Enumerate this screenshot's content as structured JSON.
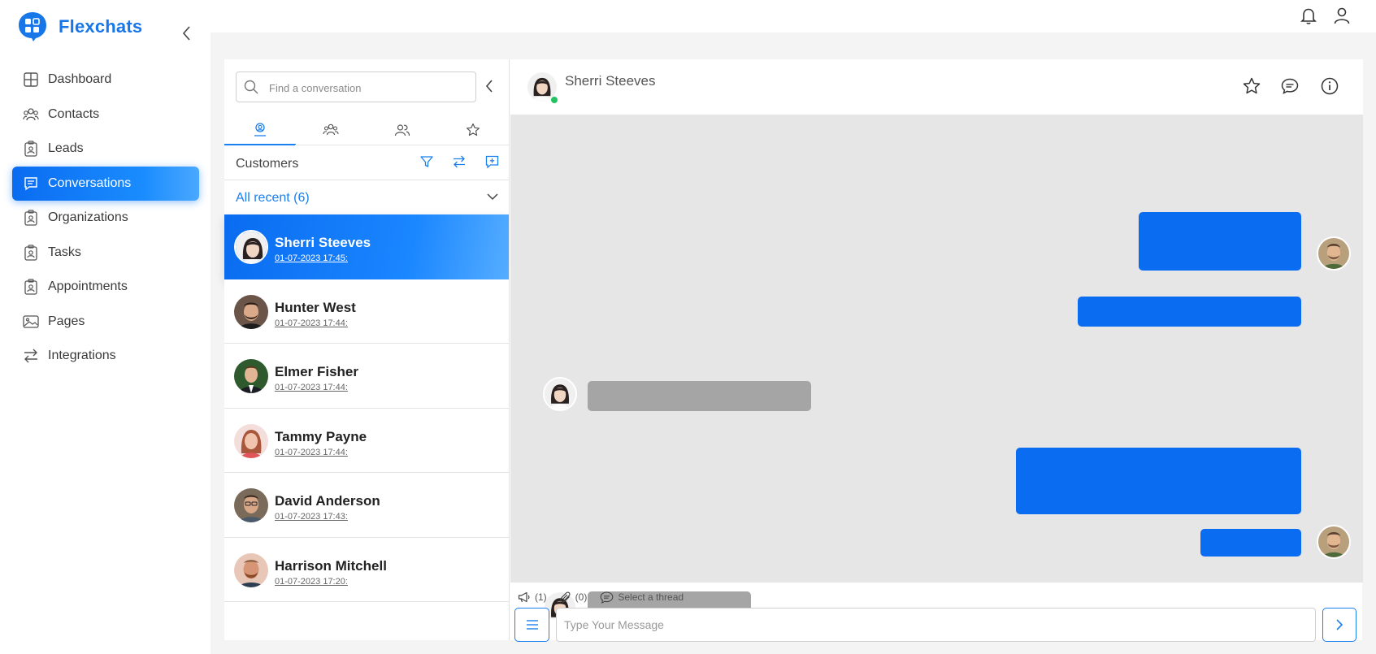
{
  "app": {
    "name": "Flexchats",
    "brand_color": "#1877e8"
  },
  "sidebar": {
    "items": [
      {
        "label": "Dashboard",
        "icon": "grid-icon"
      },
      {
        "label": "Contacts",
        "icon": "users-icon"
      },
      {
        "label": "Leads",
        "icon": "badge-icon"
      },
      {
        "label": "Conversations",
        "icon": "chat-icon",
        "active": true
      },
      {
        "label": "Organizations",
        "icon": "badge-icon"
      },
      {
        "label": "Tasks",
        "icon": "badge-icon"
      },
      {
        "label": "Appointments",
        "icon": "badge-icon"
      },
      {
        "label": "Pages",
        "icon": "image-icon"
      },
      {
        "label": "Integrations",
        "icon": "swap-icon"
      }
    ]
  },
  "topbar": {
    "icons": [
      "bell-icon",
      "user-icon"
    ]
  },
  "conversations": {
    "search_placeholder": "Find a conversation",
    "tabs": [
      "customer-icon",
      "group-icon",
      "team-icon",
      "star-icon"
    ],
    "section_title": "Customers",
    "filter_label": "All recent (6)",
    "items": [
      {
        "name": "Sherri Steeves",
        "date": "01-07-2023 17:45:",
        "active": true
      },
      {
        "name": "Hunter West",
        "date": "01-07-2023 17:44:"
      },
      {
        "name": "Elmer Fisher",
        "date": "01-07-2023 17:44:"
      },
      {
        "name": "Tammy Payne",
        "date": "01-07-2023 17:44:"
      },
      {
        "name": "David Anderson",
        "date": "01-07-2023 17:43:"
      },
      {
        "name": "Harrison Mitchell",
        "date": "01-07-2023 17:20:"
      }
    ]
  },
  "chat": {
    "contact_name": "Sherri Steeves",
    "status": "online",
    "footer": {
      "announcements": "(1)",
      "attachments": "(0)",
      "thread": "Select a thread"
    },
    "input_placeholder": "Type Your Message"
  }
}
